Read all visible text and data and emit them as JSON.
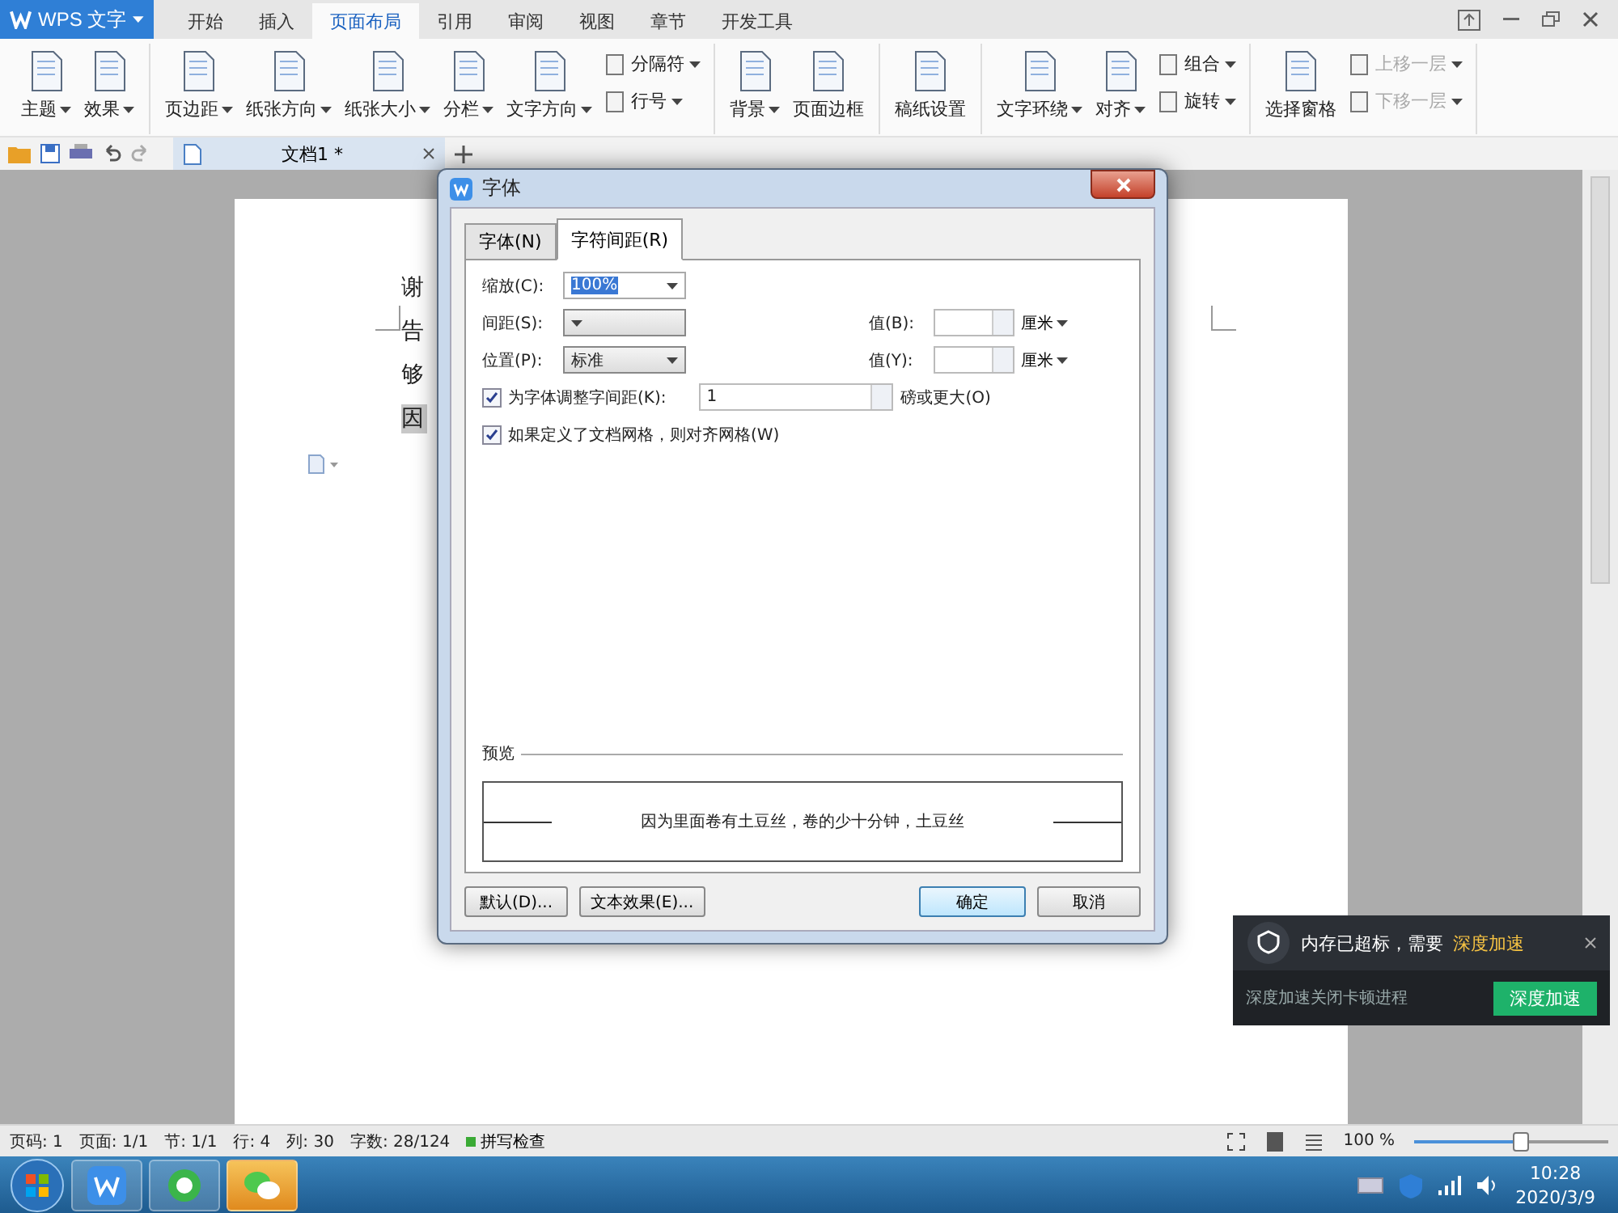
{
  "app": {
    "title": "WPS 文字"
  },
  "menu_tabs": [
    {
      "label": "开始",
      "selected": false
    },
    {
      "label": "插入",
      "selected": false
    },
    {
      "label": "页面布局",
      "selected": true
    },
    {
      "label": "引用",
      "selected": false
    },
    {
      "label": "审阅",
      "selected": false
    },
    {
      "label": "视图",
      "selected": false
    },
    {
      "label": "章节",
      "selected": false
    },
    {
      "label": "开发工具",
      "selected": false
    }
  ],
  "ribbon": {
    "groups": [
      {
        "items": [
          {
            "kind": "large",
            "label": "主题",
            "dropdown": true,
            "disabled": false
          },
          {
            "kind": "large",
            "label": "效果",
            "dropdown": true,
            "disabled": false
          }
        ]
      },
      {
        "items": [
          {
            "kind": "large",
            "label": "页边距",
            "dropdown": true,
            "disabled": false
          },
          {
            "kind": "large",
            "label": "纸张方向",
            "dropdown": true,
            "disabled": false
          },
          {
            "kind": "large",
            "label": "纸张大小",
            "dropdown": true,
            "disabled": false
          },
          {
            "kind": "large",
            "label": "分栏",
            "dropdown": true,
            "disabled": false
          },
          {
            "kind": "large",
            "label": "文字方向",
            "dropdown": true,
            "disabled": false
          },
          {
            "kind": "small",
            "label": "分隔符",
            "dropdown": true,
            "disabled": false
          },
          {
            "kind": "small",
            "label": "行号",
            "dropdown": true,
            "disabled": false
          }
        ]
      },
      {
        "items": [
          {
            "kind": "large",
            "label": "背景",
            "dropdown": true,
            "disabled": false
          },
          {
            "kind": "large",
            "label": "页面边框",
            "dropdown": false,
            "disabled": false
          }
        ]
      },
      {
        "items": [
          {
            "kind": "large",
            "label": "稿纸设置",
            "dropdown": false,
            "disabled": false
          }
        ]
      },
      {
        "items": [
          {
            "kind": "large",
            "label": "文字环绕",
            "dropdown": true,
            "disabled": false
          },
          {
            "kind": "large",
            "label": "对齐",
            "dropdown": true,
            "disabled": false
          },
          {
            "kind": "small",
            "label": "组合",
            "dropdown": true,
            "disabled": false
          },
          {
            "kind": "small",
            "label": "旋转",
            "dropdown": true,
            "disabled": false
          }
        ]
      },
      {
        "items": [
          {
            "kind": "large",
            "label": "选择窗格",
            "dropdown": false,
            "disabled": false
          },
          {
            "kind": "small",
            "label": "上移一层",
            "dropdown": true,
            "disabled": true
          },
          {
            "kind": "small",
            "label": "下移一层",
            "dropdown": true,
            "disabled": true
          }
        ]
      }
    ]
  },
  "document_tab": {
    "label": "文档1 *"
  },
  "document": {
    "lines": [
      {
        "text": "谢",
        "highlighted": false
      },
      {
        "text": "告",
        "highlighted": false
      },
      {
        "text": "够",
        "highlighted": false
      },
      {
        "text": "因",
        "highlighted": true
      }
    ]
  },
  "dialog": {
    "title": "字体",
    "tabs": [
      {
        "label": "字体(N)",
        "selected": false
      },
      {
        "label": "字符间距(R)",
        "selected": true
      }
    ],
    "scale": {
      "label": "缩放(C):",
      "value": "100%"
    },
    "spacing": {
      "label": "间距(S):",
      "value_label": "值(B):",
      "unit": "厘米"
    },
    "position": {
      "label": "位置(P):",
      "value": "标准",
      "value_label": "值(Y):",
      "unit": "厘米"
    },
    "kerning": {
      "label": "为字体调整字间距(K):",
      "checked": true,
      "value": "1",
      "suffix": "磅或更大(O)"
    },
    "snap_to_grid": {
      "label": "如果定义了文档网格，则对齐网格(W)",
      "checked": true
    },
    "preview": {
      "label": "预览",
      "text": "因为里面卷有土豆丝，卷的少十分钟，土豆丝"
    },
    "buttons": [
      {
        "label": "默认(D)...",
        "default": false
      },
      {
        "label": "文本效果(E)...",
        "default": false
      },
      {
        "label": "确定",
        "default": true
      },
      {
        "label": "取消",
        "default": false
      }
    ]
  },
  "notification": {
    "message": "内存已超标，需要",
    "highlight": "深度加速",
    "body": "深度加速关闭卡顿进程",
    "button": "深度加速"
  },
  "status_bar": {
    "items": [
      "页码: 1",
      "页面: 1/1",
      "节: 1/1",
      "行: 4",
      "列: 30",
      "字数: 28/124"
    ],
    "spell_check": "拼写检查",
    "zoom": "100 %",
    "zoom_slider": {
      "level": 0.55
    }
  },
  "taskbar": {
    "time": "10:28",
    "date": "2020/3/9"
  }
}
